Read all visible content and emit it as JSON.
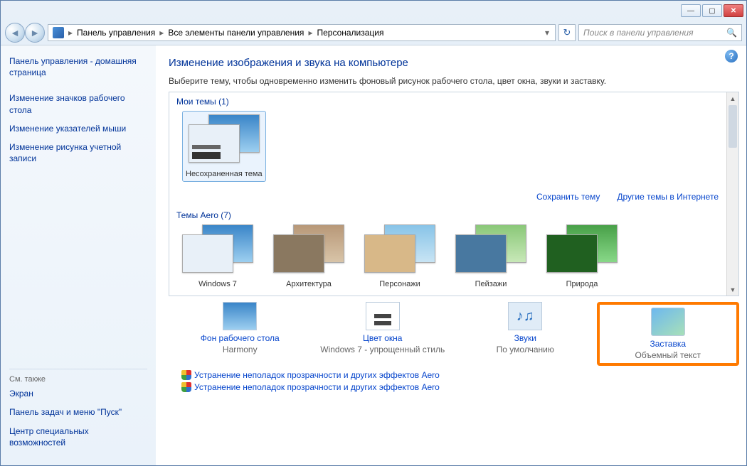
{
  "breadcrumb": {
    "p1": "Панель управления",
    "p2": "Все элементы панели управления",
    "p3": "Персонализация"
  },
  "search": {
    "placeholder": "Поиск в панели управления"
  },
  "sidebar": {
    "home": "Панель управления - домашняя страница",
    "link1": "Изменение значков рабочего стола",
    "link2": "Изменение указателей мыши",
    "link3": "Изменение рисунка учетной записи",
    "see_also": "См. также",
    "sa1": "Экран",
    "sa2": "Панель задач и меню \"Пуск\"",
    "sa3": "Центр специальных возможностей"
  },
  "main": {
    "heading": "Изменение изображения и звука на компьютере",
    "sub": "Выберите тему, чтобы одновременно изменить фоновый рисунок рабочего стола, цвет окна, звуки и заставку.",
    "my_themes": "Мои темы (1)",
    "unsaved": "Несохраненная тема",
    "save_theme": "Сохранить тему",
    "more_themes": "Другие темы в Интернете",
    "aero_themes": "Темы Aero (7)",
    "aero": {
      "t1": "Windows 7",
      "t2": "Архитектура",
      "t3": "Персонажи",
      "t4": "Пейзажи",
      "t5": "Природа"
    }
  },
  "bottom": {
    "bg": {
      "title": "Фон рабочего стола",
      "sub": "Harmony"
    },
    "color": {
      "title": "Цвет окна",
      "sub": "Windows 7 - упрощенный стиль"
    },
    "sound": {
      "title": "Звуки",
      "sub": "По умолчанию"
    },
    "saver": {
      "title": "Заставка",
      "sub": "Объемный текст"
    }
  },
  "troubleshoot": {
    "t1": "Устранение неполадок прозрачности и других эффектов Aero",
    "t2": "Устранение неполадок прозрачности и других эффектов Aero"
  }
}
